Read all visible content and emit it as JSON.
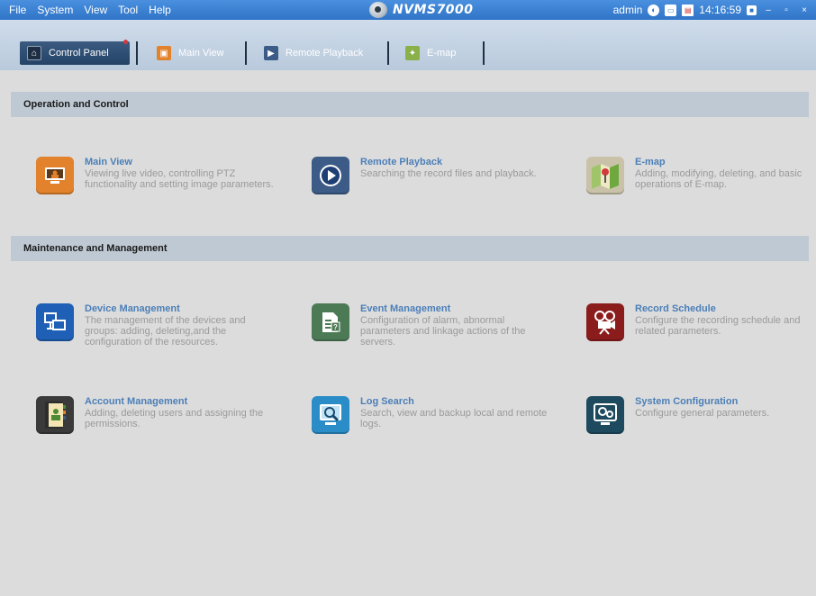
{
  "menu": [
    "File",
    "System",
    "View",
    "Tool",
    "Help"
  ],
  "app": {
    "title": "NVMS7000"
  },
  "status": {
    "user": "admin",
    "time": "14:16:59"
  },
  "tabs": [
    {
      "label": "Control Panel"
    },
    {
      "label": "Main View"
    },
    {
      "label": "Remote Playback"
    },
    {
      "label": "E-map"
    }
  ],
  "sections": [
    {
      "title": "Operation and Control"
    },
    {
      "title": "Maintenance and Management"
    }
  ],
  "cards": [
    {
      "title": "Main View",
      "desc": "Viewing live video, controlling PTZ functionality and setting image parameters.",
      "icon": "monitor-icon",
      "color": "#e2822c"
    },
    {
      "title": "Remote Playback",
      "desc": "Searching the record files and playback.",
      "icon": "playback-icon",
      "color": "#3c5b86"
    },
    {
      "title": "E-map",
      "desc": "Adding, modifying, deleting, and basic operations of E-map.",
      "icon": "map-pin-icon",
      "color": "#8ab04a"
    },
    {
      "title": "Device Management",
      "desc": "The management of the devices and groups: adding, deleting,and the configuration of the resources.",
      "icon": "devices-icon",
      "color": "#1f5fb5"
    },
    {
      "title": "Event Management",
      "desc": "Configuration of alarm, abnormal parameters and linkage actions of the servers.",
      "icon": "event-icon",
      "color": "#4c7a55"
    },
    {
      "title": "Record Schedule",
      "desc": "Configure the recording schedule and related parameters.",
      "icon": "film-camera-icon",
      "color": "#8a1c1c"
    },
    {
      "title": "Account Management",
      "desc": "Adding, deleting users and assigning the permissions.",
      "icon": "account-book-icon",
      "color": "#4f8a35"
    },
    {
      "title": "Log Search",
      "desc": "Search, view and backup local and remote logs.",
      "icon": "log-search-icon",
      "color": "#2a8dc8"
    },
    {
      "title": "System Configuration",
      "desc": "Configure general parameters.",
      "icon": "system-config-icon",
      "color": "#1e4a5f"
    }
  ]
}
